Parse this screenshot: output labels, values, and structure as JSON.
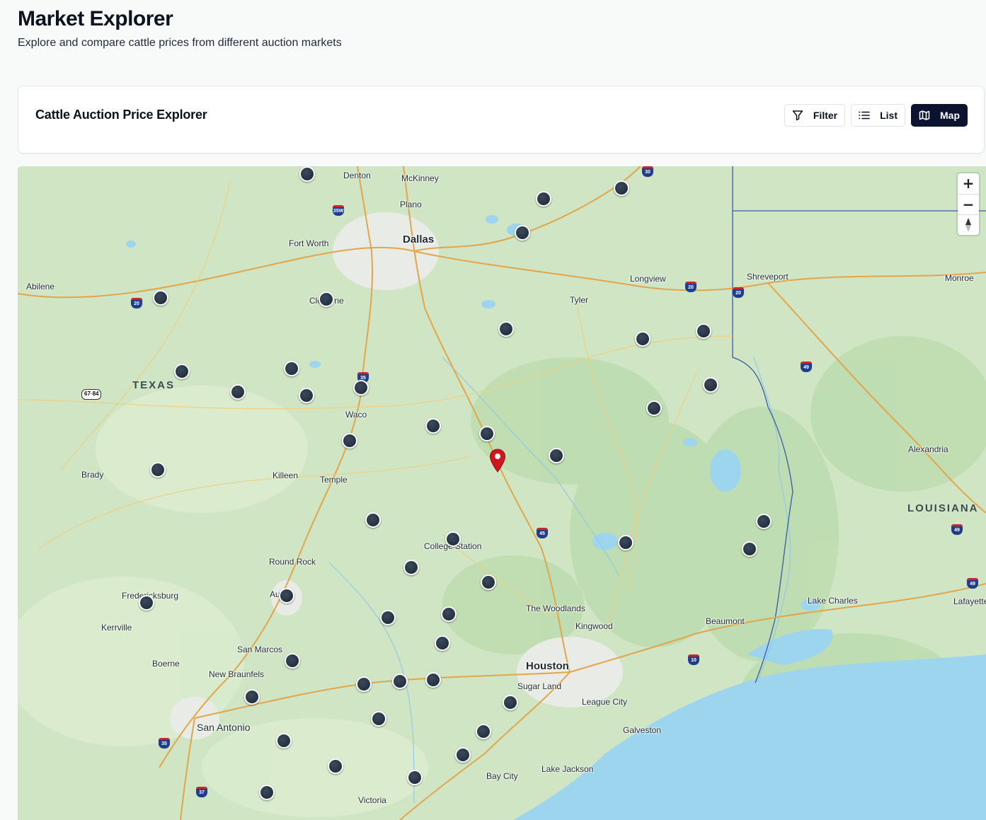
{
  "page": {
    "title": "Market Explorer",
    "subtitle": "Explore and compare cattle prices from different auction markets"
  },
  "card": {
    "title": "Cattle Auction Price Explorer",
    "buttons": {
      "filter": "Filter",
      "list": "List",
      "map": "Map"
    },
    "active_view": "map"
  },
  "icons": {
    "filter": "filter-icon",
    "list": "list-icon",
    "map": "map-icon",
    "zoom_in": "plus-icon",
    "zoom_out": "minus-icon",
    "compass": "compass-icon",
    "selected_market": "map-pin-icon",
    "market": "market-marker-icon"
  },
  "colors": {
    "accent": "#0b1330",
    "marker": "#1c2633",
    "pin": "#d0171f",
    "land": "#cfe5c4",
    "water": "#9dd5ef"
  },
  "map": {
    "zoom_in_label": "+",
    "zoom_out_label": "−",
    "regions": {
      "texas": "TEXAS",
      "louisiana": "LOUISIANA"
    },
    "cities": {
      "denton": "Denton",
      "mckinney": "McKinney",
      "plano": "Plano",
      "fort_worth": "Fort Worth",
      "dallas": "Dallas",
      "abilene": "Abilene",
      "cleburne": "Cleburne",
      "longview": "Longview",
      "tyler": "Tyler",
      "shreveport": "Shreveport",
      "monroe": "Monroe",
      "waco": "Waco",
      "brady": "Brady",
      "killeen": "Killeen",
      "temple": "Temple",
      "alexandria": "Alexandria",
      "college_station": "College Station",
      "round_rock": "Round Rock",
      "austin": "Austin",
      "fredericksburg": "Fredericksburg",
      "kerrville": "Kerrville",
      "the_woodlands": "The Woodlands",
      "kingwood": "Kingwood",
      "beaumont": "Beaumont",
      "lake_charles": "Lake Charles",
      "lafayette": "Lafayette",
      "san_marcos": "San Marcos",
      "boerne": "Boerne",
      "new_braunfels": "New Braunfels",
      "houston": "Houston",
      "sugar_land": "Sugar Land",
      "league_city": "League City",
      "san_antonio": "San Antonio",
      "galveston": "Galveston",
      "lake_jackson": "Lake Jackson",
      "bay_city": "Bay City",
      "victoria": "Victoria"
    },
    "shields": [
      "35W",
      "30",
      "20",
      "20",
      "20",
      "49",
      "35",
      "67·84",
      "45",
      "10",
      "49",
      "49",
      "35",
      "37"
    ]
  }
}
